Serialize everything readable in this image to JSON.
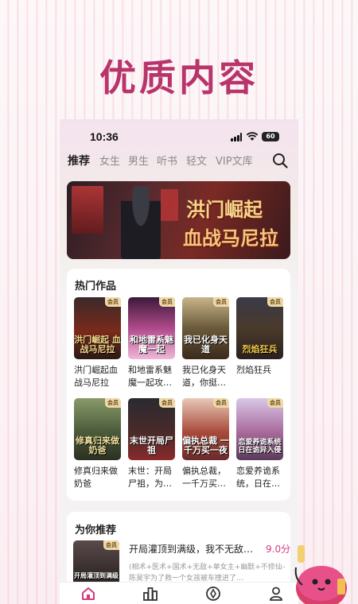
{
  "headline": "优质内容",
  "status_bar": {
    "time": "10:36",
    "battery": "60"
  },
  "tabs": [
    "推荐",
    "女生",
    "男生",
    "听书",
    "轻文",
    "VIP文库"
  ],
  "banner": {
    "line1": "洪门崛起",
    "line2": "血战马尼拉"
  },
  "hot": {
    "title": "热门作品",
    "badge": "会员",
    "books": [
      {
        "title": "洪门崛起血战马尼拉",
        "cover_text": "洪门崛起 血战马尼拉"
      },
      {
        "title": "和地雷系魅魔一起攻…",
        "cover_text": "和地雷系魅魔一起"
      },
      {
        "title": "我已化身天道，你挺…",
        "cover_text": "我已化身天道"
      },
      {
        "title": "烈焰狂兵",
        "cover_text": "烈焰狂兵"
      },
      {
        "title": "修真归来做奶爸",
        "cover_text": "修真归来做奶爸"
      },
      {
        "title": "末世：开局尸祖，为…",
        "cover_text": "末世开局尸祖"
      },
      {
        "title": "偏执总裁，一千万买…",
        "cover_text": "偏执总裁 一千万买一夜"
      },
      {
        "title": "恋爱养诡系统，日在…",
        "cover_text": "恋爱养诡系统 日在诡异入侵"
      }
    ]
  },
  "recommend": {
    "title": "为你推荐",
    "badge": "会员",
    "book": {
      "title": "开局灌顶到满级，我不无敌…",
      "score": "9.0分",
      "tags": "(相术+医术+国术+无敌+单女主+幽默+不修仙+非高武)",
      "desc": "陈昊宇为了救一个女孩被车撞进了…",
      "cover_text": "开局灌顶到满级"
    }
  },
  "colors": {
    "brand": "#b8346a",
    "score": "#d63a80",
    "badge_bg": "#f0d9a8"
  },
  "icons": [
    "search-icon",
    "home-icon",
    "ranking-icon",
    "discover-icon",
    "profile-icon"
  ]
}
